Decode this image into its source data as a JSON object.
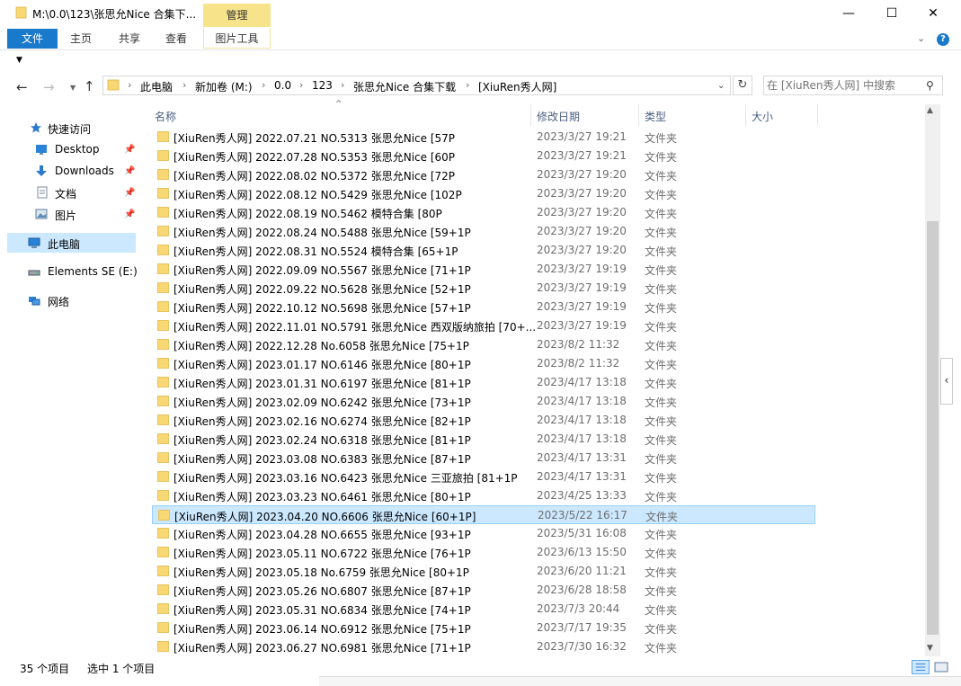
{
  "window": {
    "title": "M:\\0.0\\123\\张思允Nice 合集下...",
    "contextual_tab": "管理",
    "minimize": "—",
    "maximize": "☐",
    "close": "✕"
  },
  "ribbon": {
    "tabs": [
      "文件",
      "主页",
      "共享",
      "查看",
      "图片工具"
    ],
    "help": "?"
  },
  "address": {
    "crumbs": [
      "此电脑",
      "新加卷 (M:)",
      "0.0",
      "123",
      "张思允Nice 合集下载",
      "[XiuRen秀人网]"
    ]
  },
  "search": {
    "placeholder": "在 [XiuRen秀人网] 中搜索"
  },
  "navpane": {
    "items": [
      {
        "label": "快速访问"
      },
      {
        "label": "Desktop"
      },
      {
        "label": "Downloads"
      },
      {
        "label": "文档"
      },
      {
        "label": "图片"
      },
      {
        "label": "此电脑"
      },
      {
        "label": "Elements SE (E:)"
      },
      {
        "label": "网络"
      }
    ]
  },
  "columns": {
    "name": "名称",
    "date": "修改日期",
    "type": "类型",
    "size": "大小"
  },
  "files": [
    {
      "name": "[XiuRen秀人网] 2022.07.21 NO.5313 张思允Nice [57P",
      "date": "2023/3/27 19:21",
      "type": "文件夹"
    },
    {
      "name": "[XiuRen秀人网] 2022.07.28 NO.5353 张思允Nice [60P",
      "date": "2023/3/27 19:21",
      "type": "文件夹"
    },
    {
      "name": "[XiuRen秀人网] 2022.08.02 NO.5372 张思允Nice [72P",
      "date": "2023/3/27 19:20",
      "type": "文件夹"
    },
    {
      "name": "[XiuRen秀人网] 2022.08.12 NO.5429 张思允Nice [102P",
      "date": "2023/3/27 19:20",
      "type": "文件夹"
    },
    {
      "name": "[XiuRen秀人网] 2022.08.19 NO.5462 模特合集 [80P",
      "date": "2023/3/27 19:20",
      "type": "文件夹"
    },
    {
      "name": "[XiuRen秀人网] 2022.08.24 NO.5488 张思允Nice [59+1P",
      "date": "2023/3/27 19:20",
      "type": "文件夹"
    },
    {
      "name": "[XiuRen秀人网] 2022.08.31 NO.5524 模特合集 [65+1P",
      "date": "2023/3/27 19:20",
      "type": "文件夹"
    },
    {
      "name": "[XiuRen秀人网] 2022.09.09 NO.5567 张思允Nice  [71+1P",
      "date": "2023/3/27 19:19",
      "type": "文件夹"
    },
    {
      "name": "[XiuRen秀人网] 2022.09.22 NO.5628 张思允Nice [52+1P",
      "date": "2023/3/27 19:19",
      "type": "文件夹"
    },
    {
      "name": "[XiuRen秀人网] 2022.10.12 NO.5698 张思允Nice [57+1P",
      "date": "2023/3/27 19:19",
      "type": "文件夹"
    },
    {
      "name": "[XiuRen秀人网] 2022.11.01 NO.5791 张思允Nice 西双版纳旅拍 [70+...",
      "date": "2023/3/27 19:19",
      "type": "文件夹"
    },
    {
      "name": "[XiuRen秀人网] 2022.12.28 No.6058 张思允Nice [75+1P",
      "date": "2023/8/2 11:32",
      "type": "文件夹"
    },
    {
      "name": "[XiuRen秀人网] 2023.01.17 NO.6146 张思允Nice [80+1P",
      "date": "2023/8/2 11:32",
      "type": "文件夹"
    },
    {
      "name": "[XiuRen秀人网] 2023.01.31 NO.6197 张思允Nice [81+1P",
      "date": "2023/4/17 13:18",
      "type": "文件夹"
    },
    {
      "name": "[XiuRen秀人网] 2023.02.09 NO.6242 张思允Nice [73+1P",
      "date": "2023/4/17 13:18",
      "type": "文件夹"
    },
    {
      "name": "[XiuRen秀人网] 2023.02.16 NO.6274 张思允Nice [82+1P",
      "date": "2023/4/17 13:18",
      "type": "文件夹"
    },
    {
      "name": "[XiuRen秀人网] 2023.02.24 NO.6318 张思允Nice [81+1P",
      "date": "2023/4/17 13:18",
      "type": "文件夹"
    },
    {
      "name": "[XiuRen秀人网] 2023.03.08 NO.6383 张思允Nice [87+1P",
      "date": "2023/4/17 13:31",
      "type": "文件夹"
    },
    {
      "name": "[XiuRen秀人网] 2023.03.16 NO.6423 张思允Nice 三亚旅拍 [81+1P",
      "date": "2023/4/17 13:31",
      "type": "文件夹"
    },
    {
      "name": "[XiuRen秀人网] 2023.03.23 NO.6461 张思允Nice [80+1P",
      "date": "2023/4/25 13:33",
      "type": "文件夹"
    },
    {
      "name": "[XiuRen秀人网] 2023.04.20 NO.6606 张思允Nice [60+1P]",
      "date": "2023/5/22 16:17",
      "type": "文件夹",
      "selected": true
    },
    {
      "name": "[XiuRen秀人网] 2023.04.28 NO.6655 张思允Nice [93+1P",
      "date": "2023/5/31 16:08",
      "type": "文件夹"
    },
    {
      "name": "[XiuRen秀人网] 2023.05.11 NO.6722 张思允Nice [76+1P",
      "date": "2023/6/13 15:50",
      "type": "文件夹"
    },
    {
      "name": "[XiuRen秀人网] 2023.05.18 No.6759 张思允Nice [80+1P",
      "date": "2023/6/20 11:21",
      "type": "文件夹"
    },
    {
      "name": "[XiuRen秀人网] 2023.05.26 NO.6807 张思允Nice [87+1P",
      "date": "2023/6/28 18:58",
      "type": "文件夹"
    },
    {
      "name": "[XiuRen秀人网] 2023.05.31 NO.6834 张思允Nice [74+1P",
      "date": "2023/7/3 20:44",
      "type": "文件夹"
    },
    {
      "name": "[XiuRen秀人网] 2023.06.14 NO.6912 张思允Nice [75+1P",
      "date": "2023/7/17 19:35",
      "type": "文件夹"
    },
    {
      "name": "[XiuRen秀人网] 2023.06.27 NO.6981 张思允Nice [71+1P",
      "date": "2023/7/30 16:32",
      "type": "文件夹"
    }
  ],
  "status": {
    "count": "35 个项目",
    "selection": "选中 1 个项目"
  },
  "icons": {
    "folder": "folder-icon",
    "star": "quick-access-star-icon",
    "desktop": "desktop-icon",
    "downloads": "download-arrow-icon",
    "documents": "document-icon",
    "pictures": "picture-icon",
    "computer": "computer-icon",
    "drive": "drive-icon",
    "network": "network-icon",
    "pin": "pin-icon",
    "search": "search-icon",
    "refresh": "refresh-icon"
  },
  "colors": {
    "accent": "#1979ca",
    "selection": "#cce8ff",
    "folder": "#f8d775",
    "manage_tab": "#f7e38a"
  }
}
